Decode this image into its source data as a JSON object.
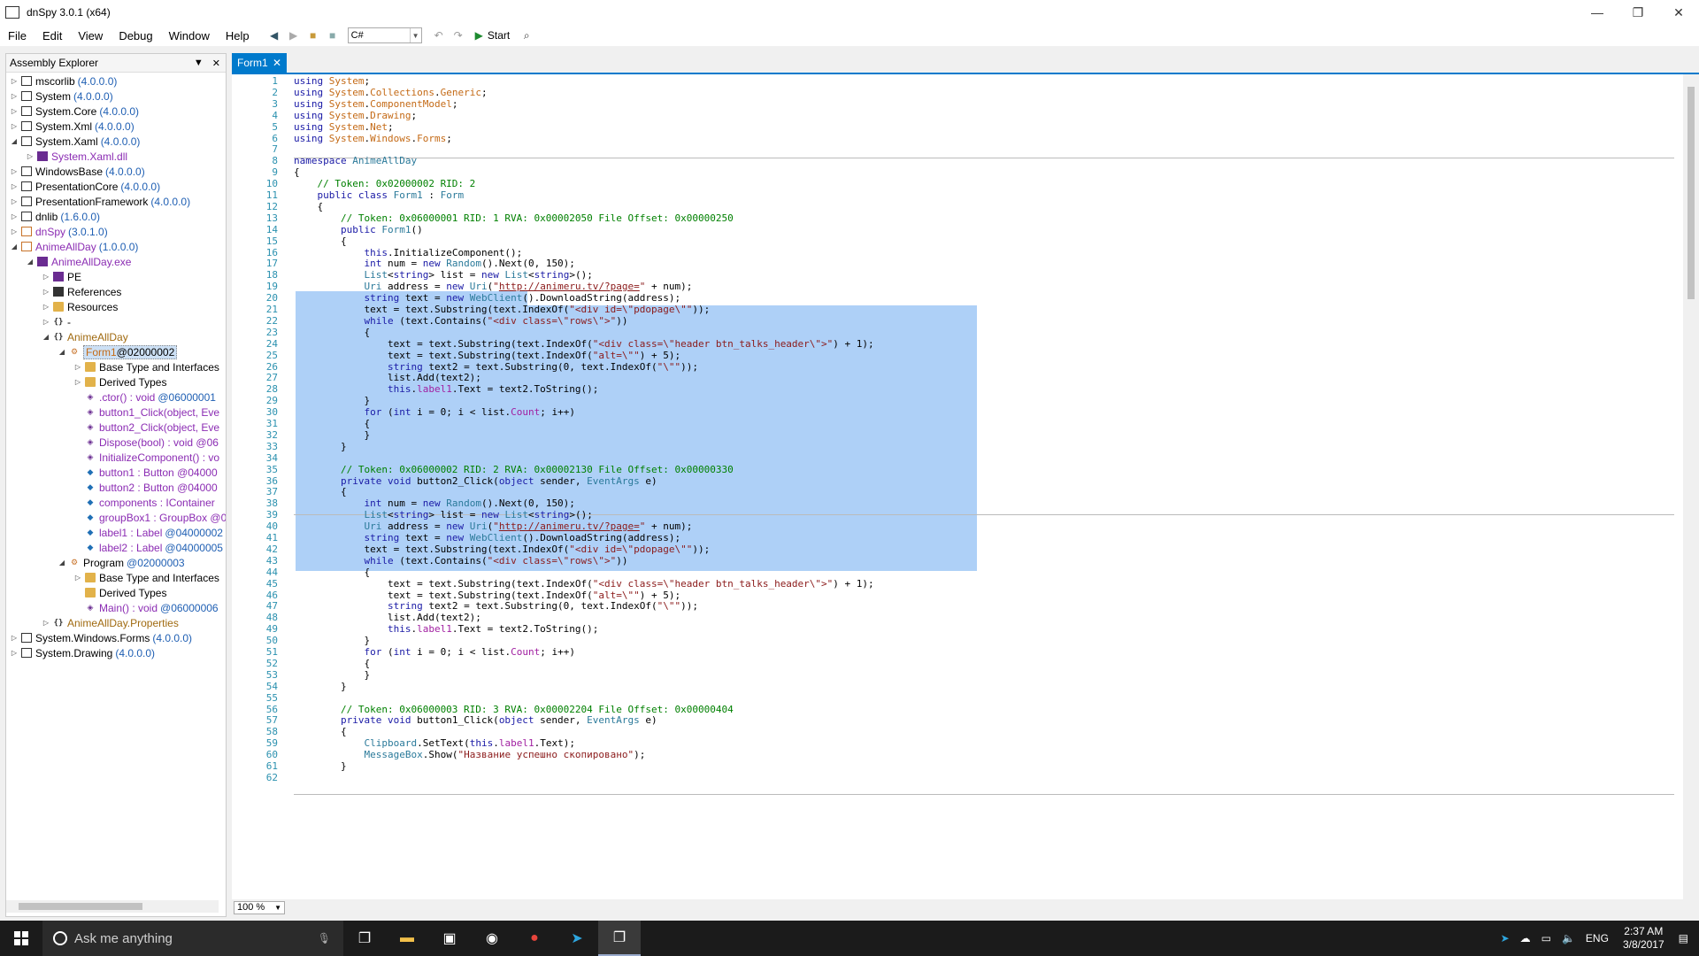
{
  "window": {
    "title": "dnSpy 3.0.1 (x64)"
  },
  "menu": [
    "File",
    "Edit",
    "View",
    "Debug",
    "Window",
    "Help"
  ],
  "toolbar": {
    "language": "C#",
    "start_label": "Start"
  },
  "explorer": {
    "title": "Assembly Explorer",
    "nodes": [
      {
        "name": "mscorlib",
        "ver": "(4.0.0.0)"
      },
      {
        "name": "System",
        "ver": "(4.0.0.0)"
      },
      {
        "name": "System.Core",
        "ver": "(4.0.0.0)"
      },
      {
        "name": "System.Xml",
        "ver": "(4.0.0.0)"
      },
      {
        "name": "System.Xaml",
        "ver": "(4.0.0.0)"
      },
      {
        "name": "System.Xaml.dll",
        "ver": ""
      },
      {
        "name": "WindowsBase",
        "ver": "(4.0.0.0)"
      },
      {
        "name": "PresentationCore",
        "ver": "(4.0.0.0)"
      },
      {
        "name": "PresentationFramework",
        "ver": "(4.0.0.0)"
      },
      {
        "name": "dnlib",
        "ver": "(1.6.0.0)"
      },
      {
        "name": "dnSpy",
        "ver": "(3.0.1.0)"
      },
      {
        "name": "AnimeAllDay",
        "ver": "(1.0.0.0)"
      },
      {
        "name": "AnimeAllDay.exe",
        "ver": ""
      },
      {
        "name": "PE",
        "ver": ""
      },
      {
        "name": "References",
        "ver": ""
      },
      {
        "name": "Resources",
        "ver": ""
      },
      {
        "name": "-",
        "ver": ""
      },
      {
        "name": "AnimeAllDay",
        "ver": ""
      },
      {
        "name": "Form1",
        "ver": "@02000002"
      },
      {
        "name": "Base Type and Interfaces",
        "ver": ""
      },
      {
        "name": "Derived Types",
        "ver": ""
      },
      {
        "name": ".ctor() : void",
        "ver": "@06000001"
      },
      {
        "name": "button1_Click(object, Eve",
        "ver": ""
      },
      {
        "name": "button2_Click(object, Eve",
        "ver": ""
      },
      {
        "name": "Dispose(bool) : void @06",
        "ver": ""
      },
      {
        "name": "InitializeComponent() : vo",
        "ver": ""
      },
      {
        "name": "button1 : Button @04000",
        "ver": ""
      },
      {
        "name": "button2 : Button @04000",
        "ver": ""
      },
      {
        "name": "components : IContainer",
        "ver": ""
      },
      {
        "name": "groupBox1 : GroupBox @0",
        "ver": ""
      },
      {
        "name": "label1 : Label",
        "ver": "@04000002"
      },
      {
        "name": "label2 : Label",
        "ver": "@04000005"
      },
      {
        "name": "Program",
        "ver": "@02000003"
      },
      {
        "name": "Base Type and Interfaces",
        "ver": ""
      },
      {
        "name": "Derived Types",
        "ver": ""
      },
      {
        "name": "Main() : void",
        "ver": "@06000006"
      },
      {
        "name": "AnimeAllDay.Properties",
        "ver": ""
      },
      {
        "name": "System.Windows.Forms",
        "ver": "(4.0.0.0)"
      },
      {
        "name": "System.Drawing",
        "ver": "(4.0.0.0)"
      }
    ]
  },
  "editor": {
    "tab": "Form1",
    "zoom": "100 %",
    "lines": [
      "using System;",
      "using System.Collections.Generic;",
      "using System.ComponentModel;",
      "using System.Drawing;",
      "using System.Net;",
      "using System.Windows.Forms;",
      "",
      "namespace AnimeAllDay",
      "{",
      "    // Token: 0x02000002 RID: 2",
      "    public class Form1 : Form",
      "    {",
      "        // Token: 0x06000001 RID: 1 RVA: 0x00002050 File Offset: 0x00000250",
      "        public Form1()",
      "        {",
      "            this.InitializeComponent();",
      "            int num = new Random().Next(0, 150);",
      "            List<string> list = new List<string>();",
      "            Uri address = new Uri(\"http://animeru.tv/?page=\" + num);",
      "            string text = new WebClient().DownloadString(address);",
      "            text = text.Substring(text.IndexOf(\"<div id=\\\"pdopage\\\"\"));",
      "            while (text.Contains(\"<div class=\\\"rows\\\">\"))",
      "            {",
      "                text = text.Substring(text.IndexOf(\"<div class=\\\"header btn_talks_header\\\">\") + 1);",
      "                text = text.Substring(text.IndexOf(\"alt=\\\"\") + 5);",
      "                string text2 = text.Substring(0, text.IndexOf(\"\\\"\"));",
      "                list.Add(text2);",
      "                this.label1.Text = text2.ToString();",
      "            }",
      "            for (int i = 0; i < list.Count; i++)",
      "            {",
      "            }",
      "        }",
      "",
      "        // Token: 0x06000002 RID: 2 RVA: 0x00002130 File Offset: 0x00000330",
      "        private void button2_Click(object sender, EventArgs e)",
      "        {",
      "            int num = new Random().Next(0, 150);",
      "            List<string> list = new List<string>();",
      "            Uri address = new Uri(\"http://animeru.tv/?page=\" + num);",
      "            string text = new WebClient().DownloadString(address);",
      "            text = text.Substring(text.IndexOf(\"<div id=\\\"pdopage\\\"\"));",
      "            while (text.Contains(\"<div class=\\\"rows\\\">\"))",
      "            {",
      "                text = text.Substring(text.IndexOf(\"<div class=\\\"header btn_talks_header\\\">\") + 1);",
      "                text = text.Substring(text.IndexOf(\"alt=\\\"\") + 5);",
      "                string text2 = text.Substring(0, text.IndexOf(\"\\\"\"));",
      "                list.Add(text2);",
      "                this.label1.Text = text2.ToString();",
      "            }",
      "            for (int i = 0; i < list.Count; i++)",
      "            {",
      "            }",
      "        }",
      "",
      "        // Token: 0x06000003 RID: 3 RVA: 0x00002204 File Offset: 0x00000404",
      "        private void button1_Click(object sender, EventArgs e)",
      "        {",
      "            Clipboard.SetText(this.label1.Text);",
      "            MessageBox.Show(\"Название успешно скопировано\");",
      "        }",
      ""
    ]
  },
  "taskbar": {
    "search_placeholder": "Ask me anything",
    "lang": "ENG",
    "time": "2:37 AM",
    "date": "3/8/2017"
  }
}
